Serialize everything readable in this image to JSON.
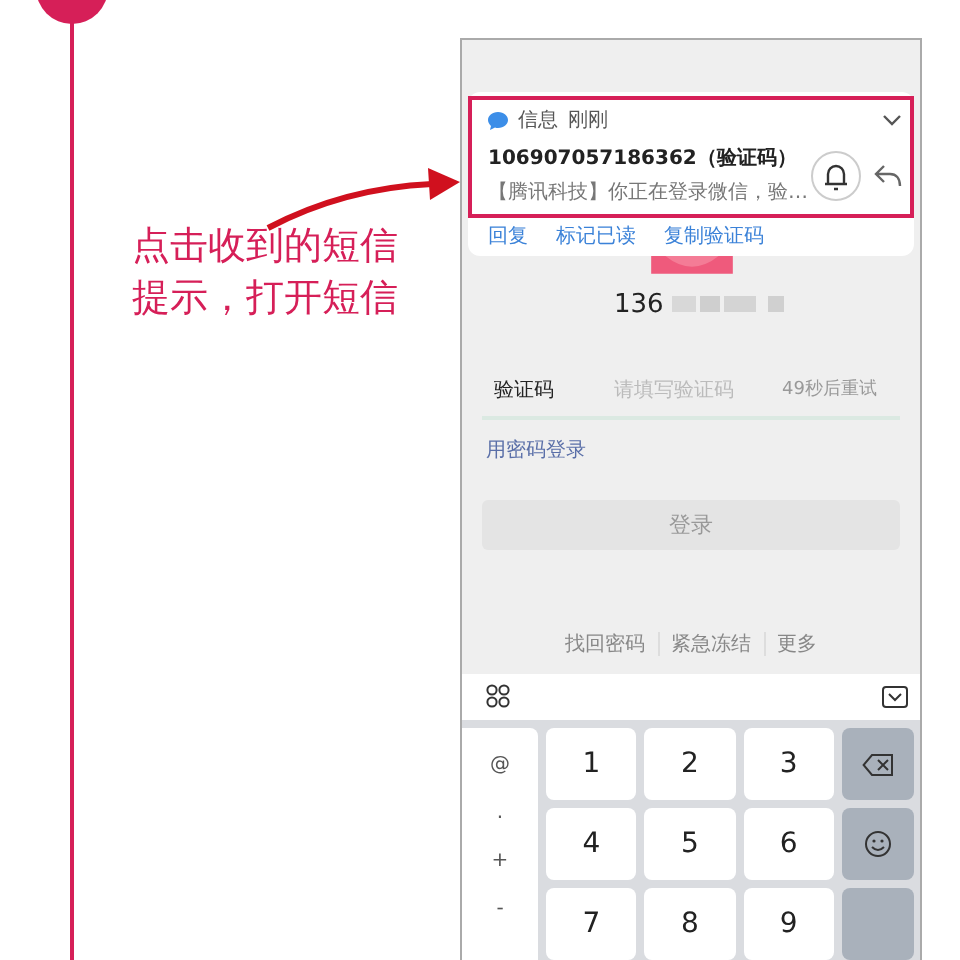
{
  "annotation": {
    "text": "点击收到的短信提示，打开短信"
  },
  "notification": {
    "app": "信息",
    "time": "刚刚",
    "sender": "106907057186362（验证码）",
    "preview": "【腾讯科技】你正在登录微信，验…",
    "actions": [
      "回复",
      "标记已读",
      "复制验证码"
    ]
  },
  "phone_number": "136",
  "code_field": {
    "label": "验证码",
    "placeholder": "请填写验证码",
    "resend": "49秒后重试"
  },
  "password_login": "用密码登录",
  "login_button": {
    "label": "登录",
    "disabled": true
  },
  "footer_links": [
    "找回密码",
    "紧急冻结",
    "更多"
  ],
  "keyboard": {
    "side_keys": [
      "@",
      ".",
      "+",
      "-"
    ],
    "keys": [
      "1",
      "2",
      "3",
      "4",
      "5",
      "6",
      "7",
      "8",
      "9"
    ]
  }
}
